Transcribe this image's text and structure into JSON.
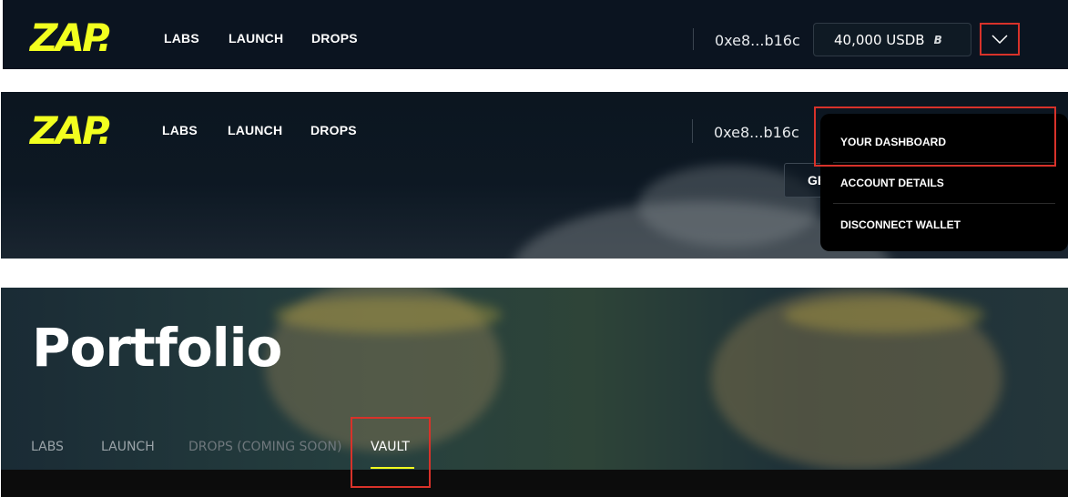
{
  "header": {
    "logo": "ZAP.",
    "nav": [
      "LABS",
      "LAUNCH",
      "DROPS"
    ],
    "wallet_address": "0xe8...b16c",
    "balance": "40,000 USDB",
    "balance_icon": "B",
    "menu_toggle_icon": "chevron-down-icon"
  },
  "dropdown": {
    "items": [
      "YOUR DASHBOARD",
      "ACCOUNT DETAILS",
      "DISCONNECT WALLET"
    ]
  },
  "partial_button": "GE",
  "portfolio": {
    "title": "Portfolio",
    "tabs": [
      "LABS",
      "LAUNCH",
      "DROPS (COMING SOON)",
      "VAULT"
    ],
    "active_tab": "VAULT"
  },
  "colors": {
    "brand_yellow": "#f2ff1f",
    "highlight_red": "#d8322a",
    "header_bg": "#0b1420"
  }
}
